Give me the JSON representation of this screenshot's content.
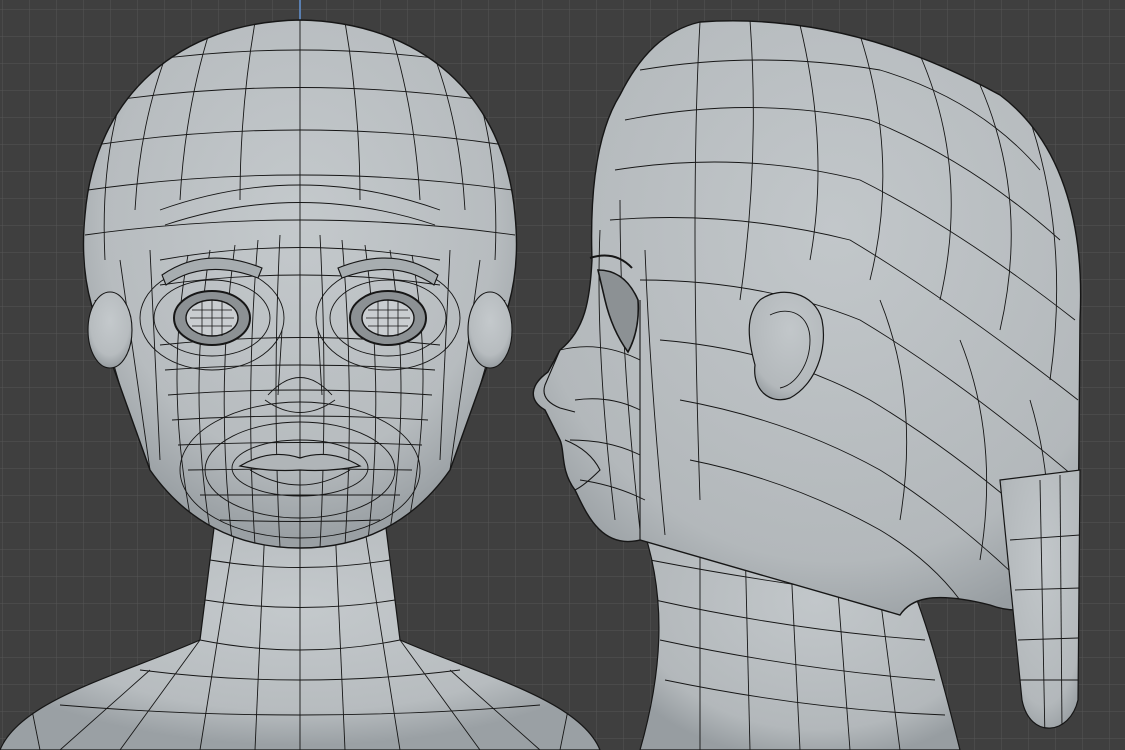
{
  "viewport": {
    "background": "#3f3f3f",
    "grid_color": "#565656",
    "axis_color": "#5a7fb0"
  },
  "model": {
    "fill": "#b9bec1",
    "fill_dark": "#9ea4a8",
    "wire": "#161616",
    "views": [
      "front-view",
      "side-view"
    ]
  }
}
